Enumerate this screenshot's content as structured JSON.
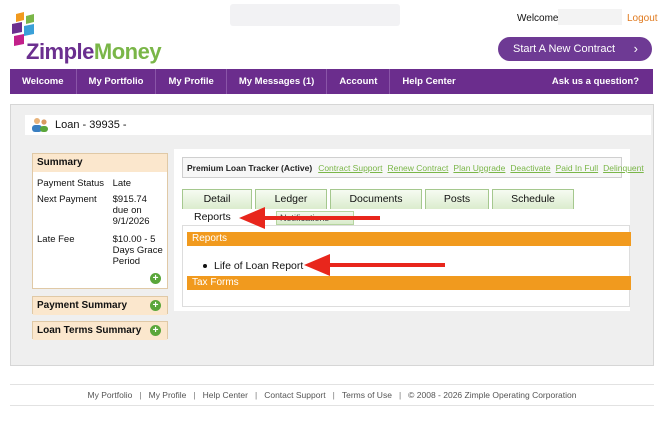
{
  "header": {
    "brand_first": "Zimple",
    "brand_second": "Money",
    "welcome": "Welcome,",
    "logout": "Logout",
    "new_contract": "Start A New Contract",
    "colors": {
      "purple": "#6b2d8d",
      "green": "#7ab648",
      "orange": "#f19a1e"
    }
  },
  "nav": {
    "items": [
      "Welcome",
      "My Portfolio",
      "My Profile",
      "My Messages (1)",
      "Account",
      "Help Center"
    ],
    "ask": "Ask us a question?"
  },
  "loan": {
    "title": "Loan - 39935 -"
  },
  "summary": {
    "title": "Summary",
    "rows": [
      {
        "label": "Payment Status",
        "value": "Late"
      },
      {
        "label": "Next Payment",
        "value": "$915.74 due on 9/1/2026"
      },
      {
        "label": "Late Fee",
        "value": "$10.00 - 5 Days Grace Period"
      }
    ],
    "payment_summary": "Payment Summary",
    "loan_terms_summary": "Loan Terms Summary"
  },
  "tracker": {
    "title": "Premium Loan Tracker (Active)",
    "links": [
      "Contract Support",
      "Renew Contract",
      "Plan Upgrade",
      "Deactivate",
      "Paid In Full",
      "Delinquent"
    ]
  },
  "tabs": [
    "Detail",
    "Ledger",
    "Documents",
    "Posts",
    "Schedule"
  ],
  "subtabs": {
    "reports": "Reports",
    "notifications": "Notifications"
  },
  "reports": {
    "section_title": "Reports",
    "items": [
      "Life of Loan Report"
    ],
    "tax_forms": "Tax Forms"
  },
  "footer": {
    "links": [
      "My Portfolio",
      "My Profile",
      "Help Center",
      "Contact Support",
      "Terms of Use"
    ],
    "copyright": "© 2008 - 2026 Zimple Operating Corporation"
  }
}
